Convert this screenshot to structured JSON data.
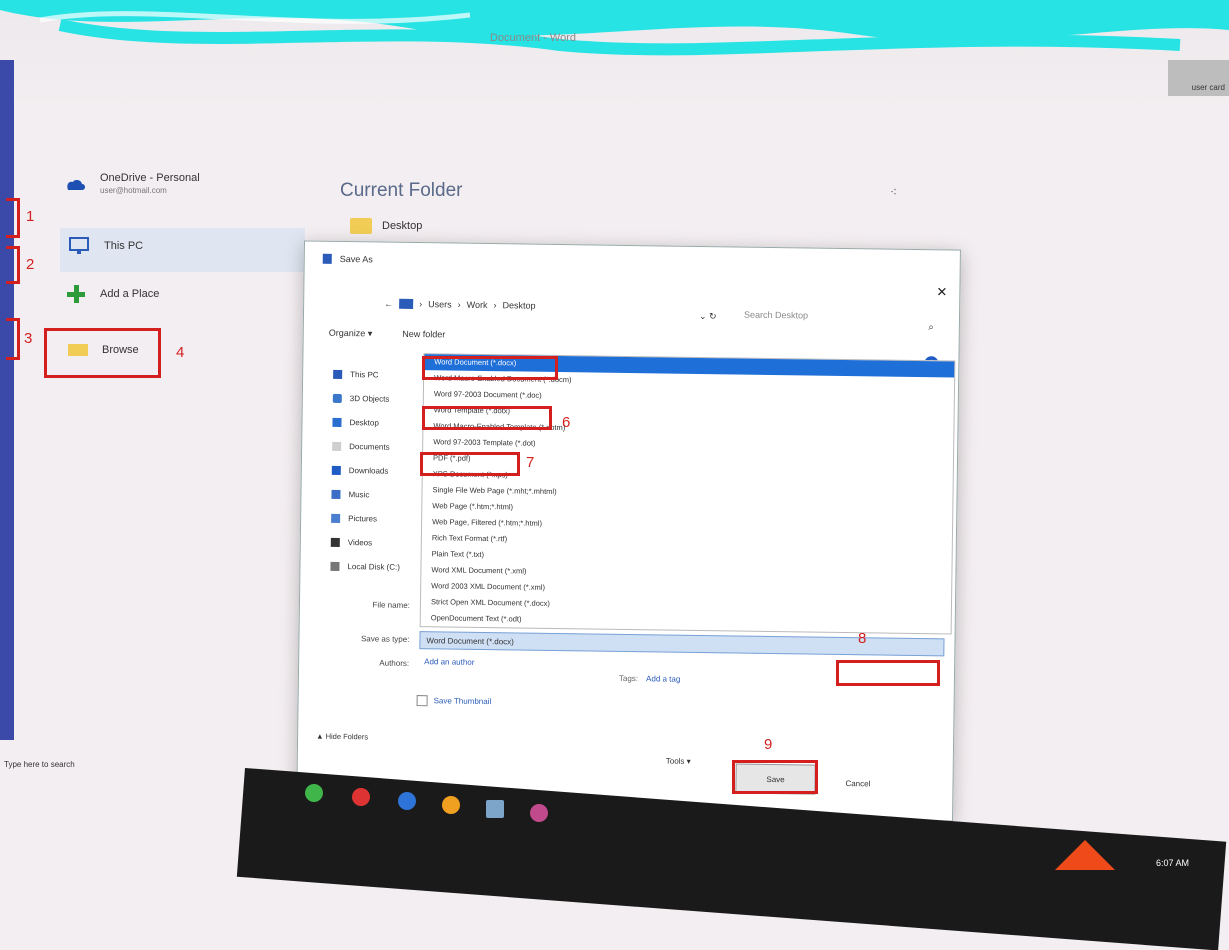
{
  "window": {
    "title": "Document - Word"
  },
  "right_thumb_label": "user card",
  "backstage": {
    "onedrive_label": "OneDrive - Personal",
    "onedrive_email": "user@hotmail.com",
    "this_pc_label": "This PC",
    "add_place_label": "Add a Place",
    "browse_label": "Browse",
    "current_folder_title": "Current Folder",
    "current_folder_name": "Desktop"
  },
  "annotations": [
    "1",
    "2",
    "3",
    "4",
    "6",
    "7",
    "8",
    "9"
  ],
  "dialog": {
    "title": "Save As",
    "breadcrumb": [
      "Users",
      "Work",
      "Desktop"
    ],
    "search_placeholder": "Search Desktop",
    "organize_label": "Organize ▾",
    "new_folder_label": "New folder",
    "nav_items": [
      "This PC",
      "3D Objects",
      "Desktop",
      "Documents",
      "Downloads",
      "Music",
      "Pictures",
      "Videos",
      "Local Disk (C:)"
    ],
    "file_types": [
      "Word Document (*.docx)",
      "Word Macro-Enabled Document (*.docm)",
      "Word 97-2003 Document (*.doc)",
      "Word Template (*.dotx)",
      "Word Macro-Enabled Template (*.dotm)",
      "Word 97-2003 Template (*.dot)",
      "PDF (*.pdf)",
      "XPS Document (*.xps)",
      "Single File Web Page (*.mht;*.mhtml)",
      "Web Page (*.htm;*.html)",
      "Web Page, Filtered (*.htm;*.html)",
      "Rich Text Format (*.rtf)",
      "Plain Text (*.txt)",
      "Word XML Document (*.xml)",
      "Word 2003 XML Document (*.xml)",
      "Strict Open XML Document (*.docx)",
      "OpenDocument Text (*.odt)"
    ],
    "file_name_label": "File name:",
    "save_as_type_label": "Save as type:",
    "save_as_type_value": "Word Document (*.docx)",
    "authors_label": "Authors:",
    "authors_value": "Add an author",
    "tags_label": "Tags:",
    "tags_value": "Add a tag",
    "thumbnail_label": "Save Thumbnail",
    "hide_folders_label": "▲ Hide Folders",
    "tools_label": "Tools ▾",
    "save_label": "Save",
    "cancel_label": "Cancel"
  },
  "taskbar": {
    "search_text": "Type here to search",
    "clock": "6:07 AM"
  },
  "colors": {
    "accent": "#1f6fd8",
    "annotation": "#d41f1f",
    "scribble": "#27e3e3"
  }
}
